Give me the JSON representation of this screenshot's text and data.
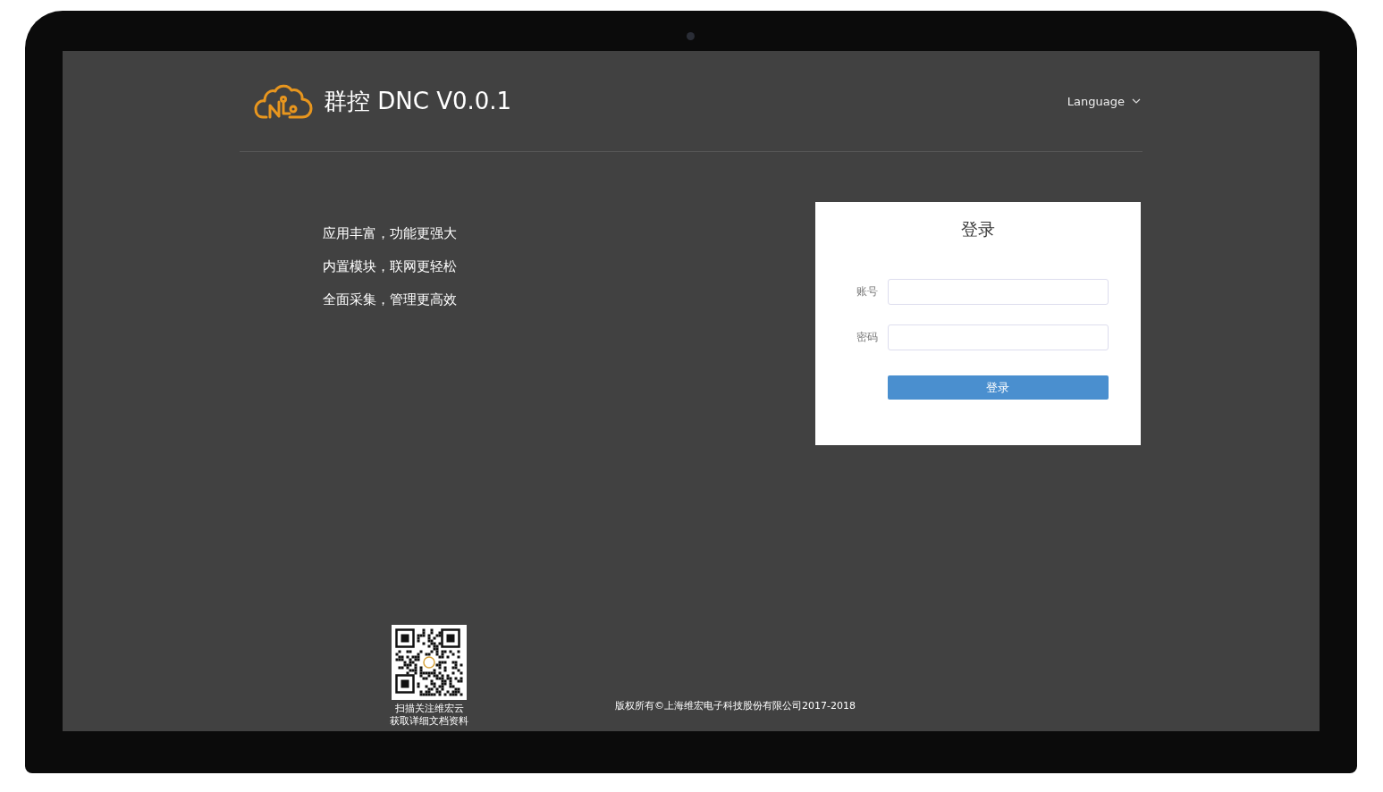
{
  "header": {
    "title": "群控 DNC V0.0.1",
    "language_menu": {
      "label": "Language"
    }
  },
  "taglines": [
    "应用丰富，功能更强大",
    "内置模块，联网更轻松",
    "全面采集，管理更高效"
  ],
  "login": {
    "title": "登录",
    "fields": [
      {
        "label": "账号"
      },
      {
        "label": "密码"
      }
    ],
    "submit": "登录"
  },
  "footer": {
    "qr_caption": [
      "扫描关注维宏云",
      "获取详细文档资料"
    ],
    "copyright": "版权所有©上海维宏电子科技股份有限公司2017-2018"
  }
}
